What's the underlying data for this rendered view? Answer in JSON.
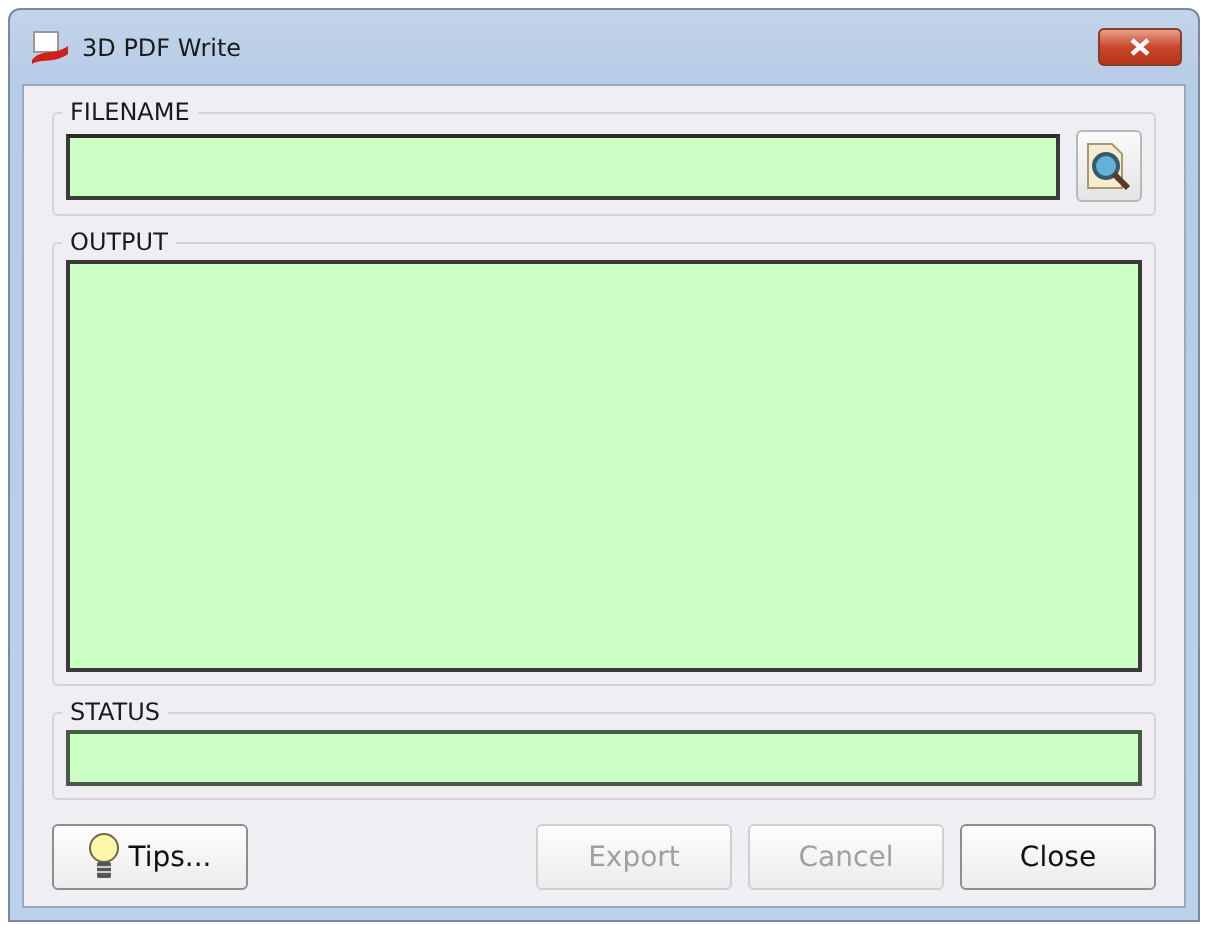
{
  "window": {
    "title": "3D PDF Write"
  },
  "groups": [
    {
      "kind": "filename",
      "label": "FILENAME"
    },
    {
      "kind": "output",
      "label": "OUTPUT"
    },
    {
      "kind": "status",
      "label": "STATUS"
    }
  ],
  "buttons": [
    {
      "kind": "tips",
      "label": "Tips...",
      "disabled": false
    },
    {
      "kind": "plain",
      "label": "Export",
      "disabled": true
    },
    {
      "kind": "plain",
      "label": "Cancel",
      "disabled": true
    },
    {
      "kind": "plain",
      "label": "Close",
      "disabled": false
    }
  ]
}
